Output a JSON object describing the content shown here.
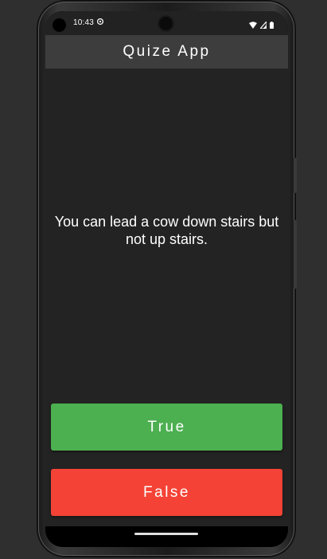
{
  "status_bar": {
    "time": "10:43",
    "icons": [
      "settings-icon",
      "wifi-icon",
      "signal-icon",
      "battery-icon"
    ]
  },
  "app_bar": {
    "title": "Quize App"
  },
  "question": {
    "text": "You can lead a cow down stairs but not up stairs."
  },
  "buttons": {
    "true_label": "True",
    "false_label": "False"
  },
  "colors": {
    "true_button": "#4caf50",
    "false_button": "#f44336",
    "app_bar": "#3d3d3d",
    "background": "#232323"
  }
}
